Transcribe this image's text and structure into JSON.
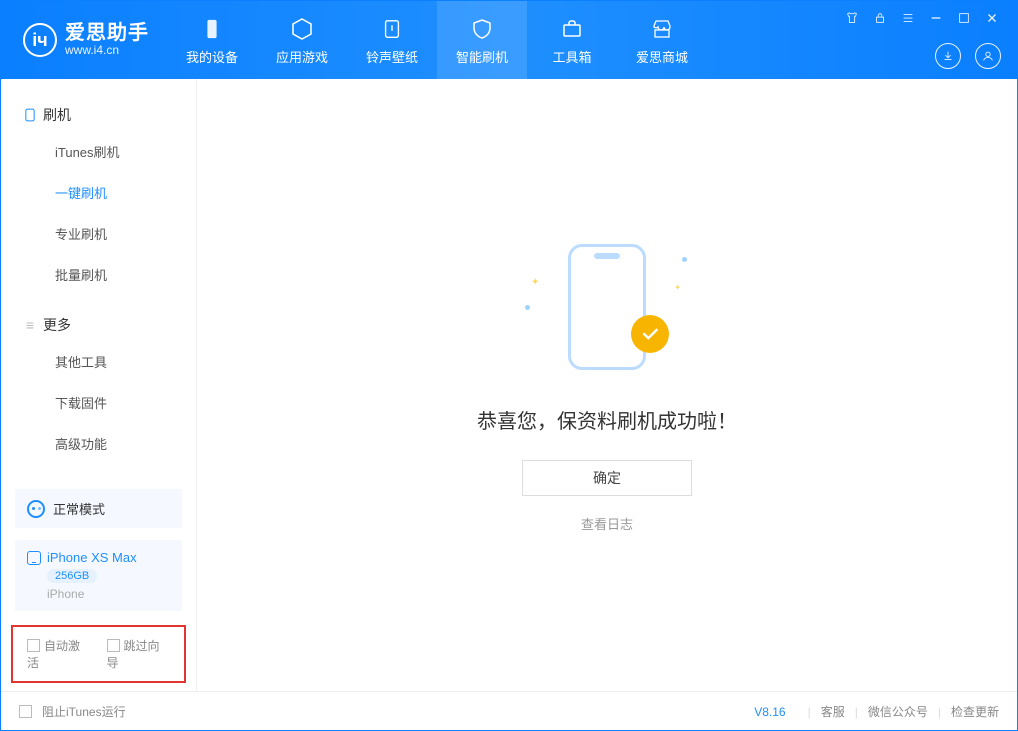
{
  "app": {
    "title": "爱思助手",
    "domain": "www.i4.cn"
  },
  "tabs": {
    "device": "我的设备",
    "apps": "应用游戏",
    "ringtones": "铃声壁纸",
    "flash": "智能刷机",
    "toolbox": "工具箱",
    "store": "爱思商城"
  },
  "sidebar": {
    "group_flash": "刷机",
    "items_flash": {
      "itunes": "iTunes刷机",
      "oneclick": "一键刷机",
      "pro": "专业刷机",
      "batch": "批量刷机"
    },
    "group_more": "更多",
    "items_more": {
      "other_tools": "其他工具",
      "download_fw": "下载固件",
      "advanced": "高级功能"
    }
  },
  "mode": {
    "label": "正常模式"
  },
  "device": {
    "name": "iPhone XS Max",
    "capacity": "256GB",
    "subtitle": "iPhone"
  },
  "options": {
    "auto_activate": "自动激活",
    "skip_guide": "跳过向导"
  },
  "main": {
    "message": "恭喜您，保资料刷机成功啦！",
    "confirm": "确定",
    "view_log": "查看日志"
  },
  "footer": {
    "block_itunes": "阻止iTunes运行",
    "version": "V8.16",
    "support": "客服",
    "wechat": "微信公众号",
    "update": "检查更新"
  }
}
